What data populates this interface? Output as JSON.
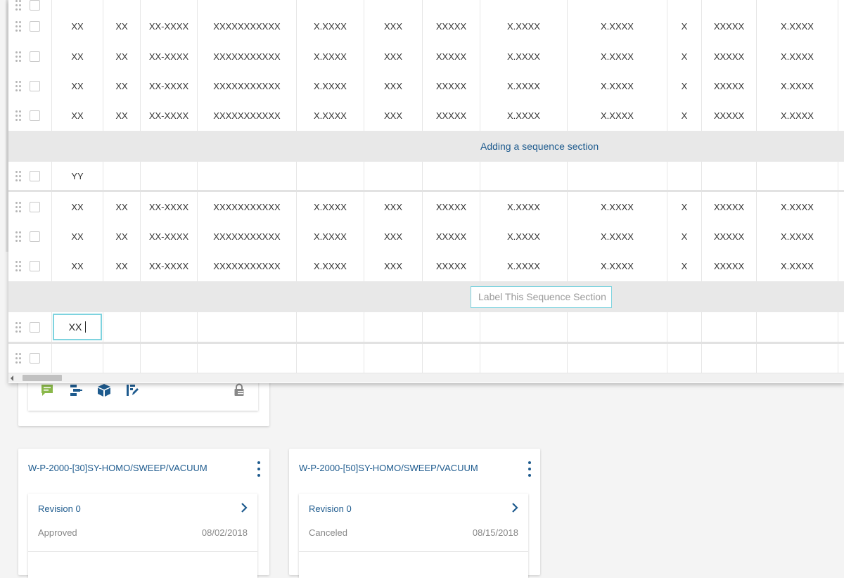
{
  "table": {
    "data_cells": [
      "XX",
      "XX",
      "XX-XXXX",
      "XXXXXXXXXXX",
      "X.XXXX",
      "XXX",
      "XXXXX",
      "X.XXXX",
      "X.XXXX",
      "X",
      "XXXXX",
      "X.XXXX"
    ],
    "header_row_value": "YY",
    "section_label": "Adding a sequence section",
    "new_section_input": {
      "value": "",
      "placeholder": "Label This Sequence Section"
    },
    "editing_cell_value": "XX"
  },
  "cards": [
    {
      "title": "W-P-2000-[30]SY-HOMO/SWEEP/VACUUM",
      "revision": {
        "title": "Revision 0",
        "status": "Approved",
        "date": "08/02/2018"
      }
    },
    {
      "title": "W-P-2000-[50]SY-HOMO/SWEEP/VACUUM",
      "revision": {
        "title": "Revision 0",
        "status": "Canceled",
        "date": "08/15/2018"
      }
    }
  ],
  "toolbar_icons": [
    "comment-icon",
    "workflow-icon",
    "package-icon",
    "edit-document-icon",
    "lock-icon"
  ],
  "colors": {
    "link_blue": "#1e5b8e",
    "focus_cyan": "#7ed3df",
    "comment_green": "#8ab84a",
    "section_gray": "#e8e8e8"
  }
}
